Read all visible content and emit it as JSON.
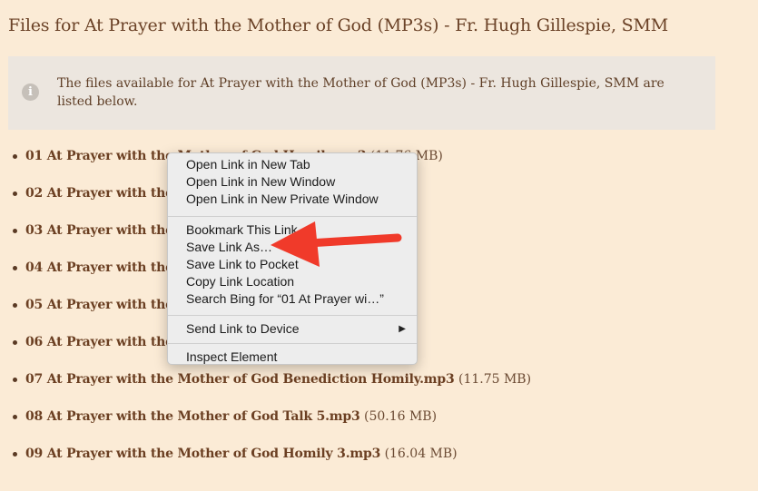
{
  "page": {
    "title": "Files for At Prayer with the Mother of God (MP3s) - Fr. Hugh Gillespie, SMM"
  },
  "info": {
    "icon": "info-icon",
    "glyph": "i",
    "text": "The files available for At Prayer with the Mother of God (MP3s) - Fr. Hugh Gillespie, SMM are listed below."
  },
  "files": [
    {
      "name": "01 At Prayer with the Mother of God Homily.mp3",
      "size": "(11.76 MB)"
    },
    {
      "name": "02 At Prayer with the",
      "size": ""
    },
    {
      "name": "03 At Prayer with the",
      "size": ""
    },
    {
      "name": "04 At Prayer with the",
      "size": ""
    },
    {
      "name": "05 At Prayer with the",
      "size": ""
    },
    {
      "name": "06 At Prayer with the",
      "size": ""
    },
    {
      "name": "07 At Prayer with the Mother of God Benediction Homily.mp3",
      "size": "(11.75 MB)"
    },
    {
      "name": "08 At Prayer with the Mother of God Talk 5.mp3",
      "size": "(50.16 MB)"
    },
    {
      "name": "09 At Prayer with the Mother of God Homily 3.mp3",
      "size": "(16.04 MB)"
    }
  ],
  "context_menu": {
    "open_new_tab": "Open Link in New Tab",
    "open_new_window": "Open Link in New Window",
    "open_private_window": "Open Link in New Private Window",
    "bookmark": "Bookmark This Link",
    "save_link_as": "Save Link As…",
    "save_to_pocket": "Save Link to Pocket",
    "copy_location": "Copy Link Location",
    "search_bing": "Search Bing for “01 At Prayer wi…”",
    "send_to_device": "Send Link to Device",
    "submenu_arrow": "▶",
    "inspect": "Inspect Element"
  },
  "colors": {
    "background": "#fbebd6",
    "info_box": "#ece6df",
    "link": "#6b3f22",
    "annotation_arrow": "#f03a2a"
  }
}
